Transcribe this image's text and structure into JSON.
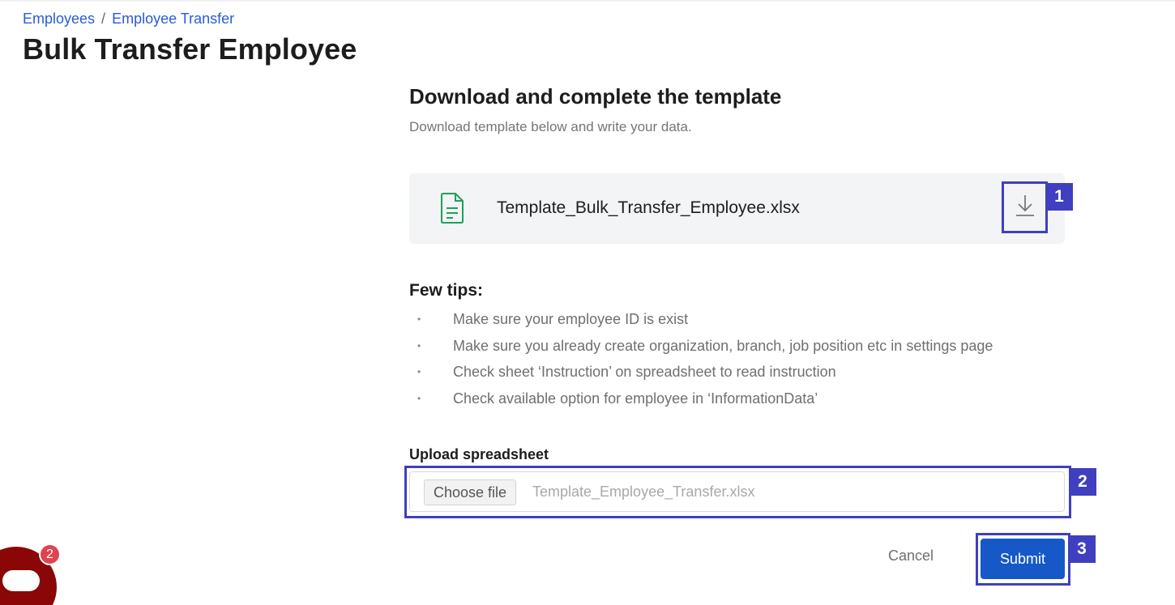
{
  "breadcrumb": {
    "items": [
      "Employees",
      "Employee Transfer"
    ],
    "separator": "/"
  },
  "page": {
    "title": "Bulk Transfer Employee"
  },
  "template_section": {
    "title": "Download and complete the template",
    "subtitle": "Download template below and write your data.",
    "file_name": "Template_Bulk_Transfer_Employee.xlsx",
    "file_icon": "spreadsheet-file-icon",
    "download_icon": "download-icon"
  },
  "tips": {
    "title": "Few tips:",
    "bullet": "•",
    "items": [
      "Make sure your employee ID is exist",
      "Make sure you already create organization, branch, job position etc in settings page",
      "Check sheet ‘Instruction’ on spreadsheet to read instruction",
      "Check available option for employee in ‘InformationData’"
    ]
  },
  "upload": {
    "label": "Upload spreadsheet",
    "choose_button": "Choose file",
    "file_name": "Template_Employee_Transfer.xlsx"
  },
  "actions": {
    "cancel_label": "Cancel",
    "submit_label": "Submit"
  },
  "annotations": {
    "badges": [
      "1",
      "2",
      "3"
    ],
    "color": "#3f3fbf"
  },
  "chat_widget": {
    "unread_count": "2",
    "icon": "chat-bubble-icon"
  },
  "colors": {
    "link": "#2a5bd7",
    "primary_button": "#1658c7",
    "file_icon": "#1fa05a",
    "chat_widget": "#8b0707",
    "badge": "#e0434f"
  }
}
